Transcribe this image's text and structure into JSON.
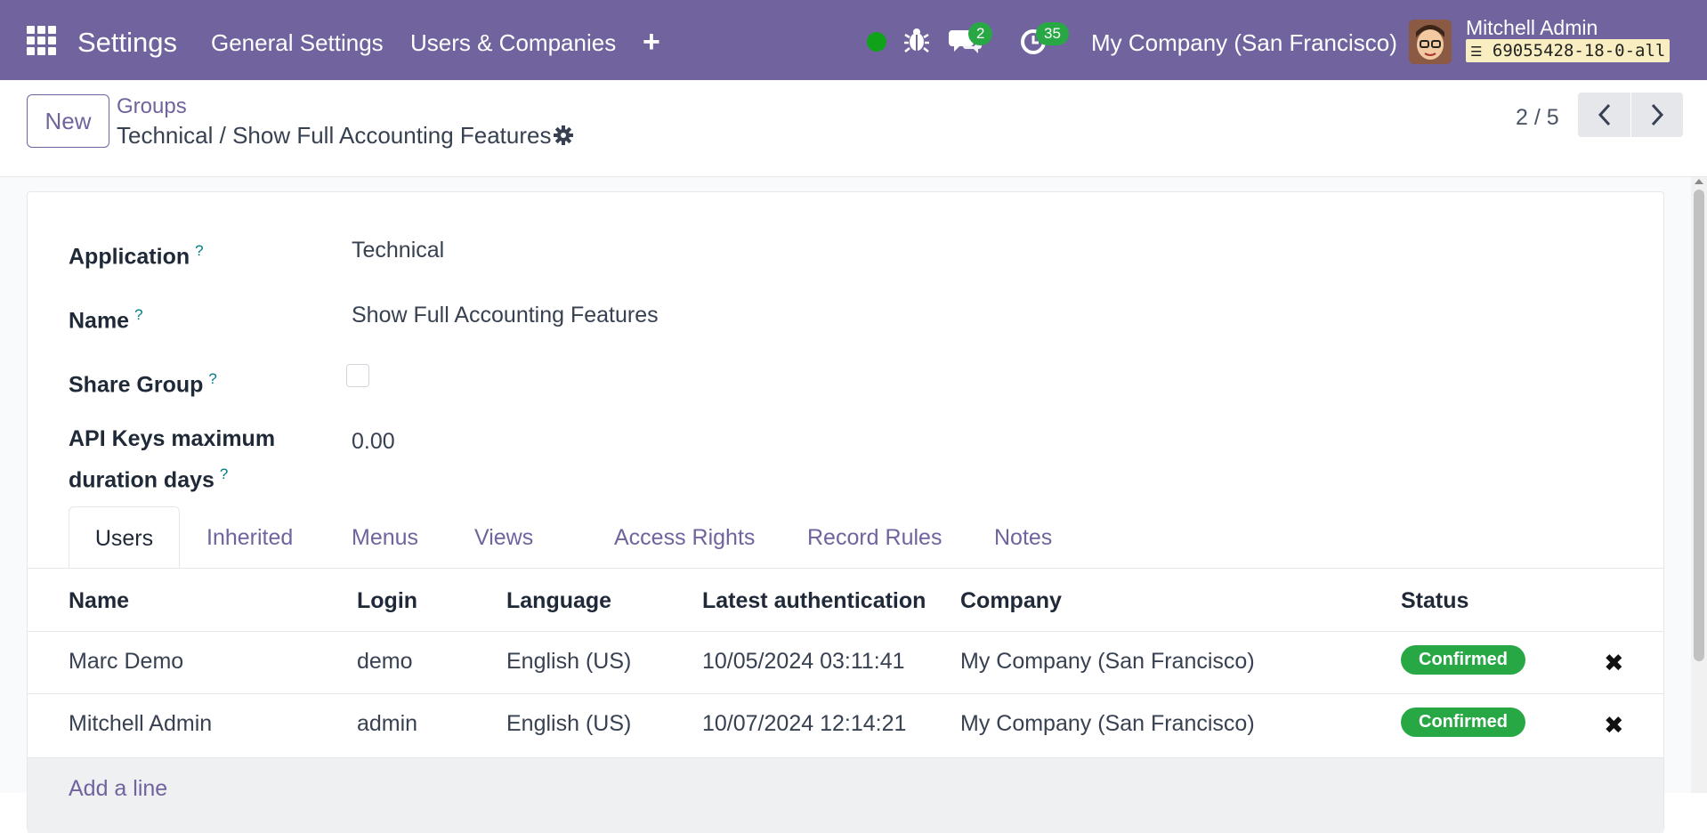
{
  "navbar": {
    "brand": "Settings",
    "menus": [
      "General Settings",
      "Users & Companies"
    ],
    "plus": "+",
    "messages_count": "2",
    "activities_count": "35",
    "company": "My Company (San Francisco)",
    "user_name": "Mitchell Admin",
    "db_name": "69055428-18-0-all",
    "color": "#71639e",
    "status_color": "#10a31a"
  },
  "control_panel": {
    "new_label": "New",
    "breadcrumb_parent": "Groups",
    "breadcrumb_current": "Technical / Show Full Accounting Features",
    "pager": "2 / 5"
  },
  "form": {
    "fields": [
      {
        "label": "Application",
        "value": "Technical"
      },
      {
        "label": "Name",
        "value": "Show Full Accounting Features"
      },
      {
        "label": "Share Group",
        "checked": false
      },
      {
        "label_line1": "API Keys maximum",
        "label_line2": "duration days",
        "value": "0.00"
      }
    ],
    "help_marker": "?"
  },
  "tabs": [
    "Users",
    "Inherited",
    "Menus",
    "Views",
    "Access Rights",
    "Record Rules",
    "Notes"
  ],
  "active_tab": "Users",
  "table": {
    "headers": [
      "Name",
      "Login",
      "Language",
      "Latest authentication",
      "Company",
      "Status"
    ],
    "rows": [
      {
        "name": "Marc Demo",
        "login": "demo",
        "language": "English (US)",
        "latest_auth": "10/05/2024 03:11:41",
        "company": "My Company (San Francisco)",
        "status": "Confirmed"
      },
      {
        "name": "Mitchell Admin",
        "login": "admin",
        "language": "English (US)",
        "latest_auth": "10/07/2024 12:14:21",
        "company": "My Company (San Francisco)",
        "status": "Confirmed"
      }
    ],
    "add_line": "Add a line",
    "remove_glyph": "✖",
    "status_color": "#28a745"
  }
}
